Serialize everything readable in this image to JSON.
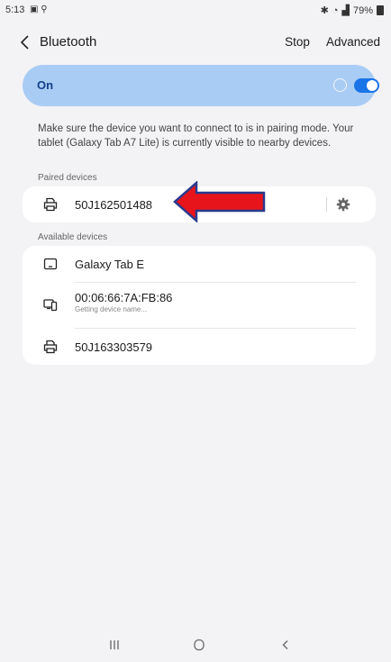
{
  "status_bar": {
    "time": "5:13",
    "left_icons": [
      "notification-icon",
      "location-icon"
    ],
    "right_icons": [
      "bluetooth-status-icon",
      "wifi-icon",
      "signal-icon"
    ],
    "battery": "79%"
  },
  "header": {
    "title": "Bluetooth",
    "stop_label": "Stop",
    "advanced_label": "Advanced"
  },
  "toggle": {
    "label": "On",
    "enabled": true,
    "accent": "#1a74e8",
    "card_color": "#a9ccf4"
  },
  "info_text": "Make sure the device you want to connect to is in pairing mode. Your tablet (Galaxy Tab A7 Lite) is currently visible to nearby devices.",
  "paired": {
    "label": "Paired devices",
    "devices": [
      {
        "name": "50J162501488",
        "icon": "printer-icon"
      }
    ]
  },
  "available": {
    "label": "Available devices",
    "devices": [
      {
        "name": "Galaxy Tab E",
        "icon": "tablet-icon"
      },
      {
        "name": "00:06:66:7A:FB:86",
        "sub": "Getting device name...",
        "icon": "devices-icon"
      },
      {
        "name": "50J163303579",
        "icon": "printer-icon"
      }
    ]
  },
  "annotation": {
    "color": "#e8141c",
    "outline": "#2a3a8c"
  },
  "nav_bar": [
    "recents-icon",
    "home-icon",
    "back-icon"
  ]
}
